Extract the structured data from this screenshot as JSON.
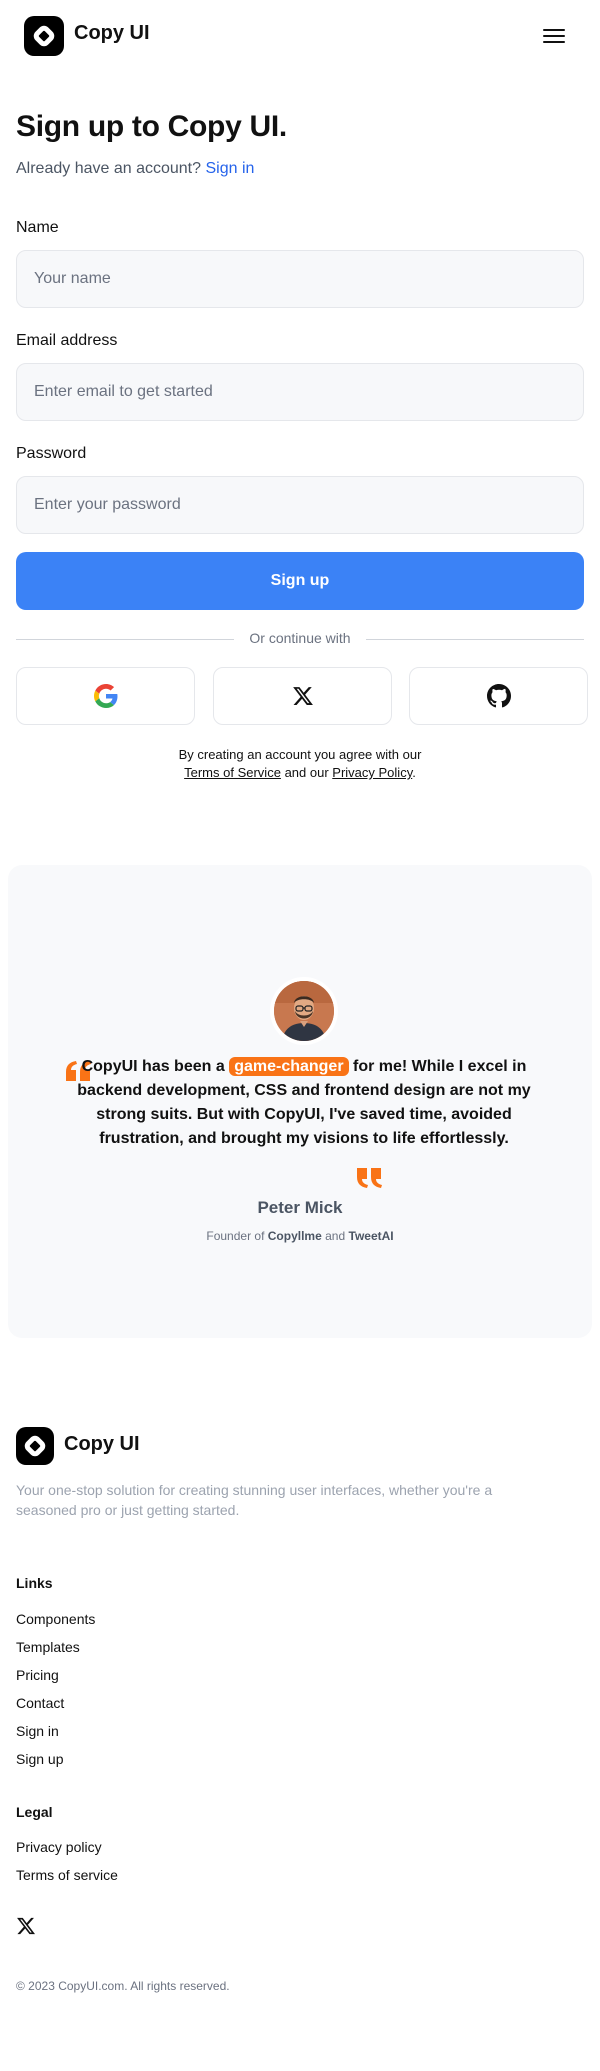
{
  "header": {
    "brand": "Copy UI",
    "menu_icon": "hamburger-menu-icon"
  },
  "signup": {
    "title": "Sign up to Copy UI.",
    "have_account": "Already have an account?",
    "signin_link": "Sign in",
    "name_label": "Name",
    "name_placeholder": "Your name",
    "email_label": "Email address",
    "email_placeholder": "Enter email to get started",
    "password_label": "Password",
    "password_placeholder": "Enter your password",
    "submit": "Sign up",
    "divider": "Or continue with",
    "social": [
      "google-icon",
      "x-icon",
      "github-icon"
    ],
    "terms_prefix": "By creating an account you agree with our",
    "terms_link": "Terms of Service",
    "terms_and": "and our",
    "privacy_link": "Privacy Policy",
    "terms_end": "."
  },
  "testimonial": {
    "quote_before": "CopyUI has been a ",
    "highlight": "game-changer",
    "quote_after": " for me! While I excel in backend development, CSS and frontend design are not my strong suits. But with CopyUI, I've saved time, avoided frustration, and brought my visions to life effortlessly.",
    "name": "Peter Mick",
    "role_prefix": "Founder of",
    "company1": "Copyllme",
    "role_and": "and",
    "company2": "TweetAI",
    "accent": "#f97316"
  },
  "footer": {
    "brand": "Copy UI",
    "tagline": "Your one-stop solution for creating stunning user interfaces, whether you're a seasoned pro or just getting started.",
    "links_heading": "Links",
    "links": [
      "Components",
      "Templates",
      "Pricing",
      "Contact",
      "Sign in",
      "Sign up"
    ],
    "legal_heading": "Legal",
    "legal": [
      "Privacy policy",
      "Terms of service"
    ],
    "social_icon": "x-icon",
    "copyright": "© 2023 CopyUI.com. All rights reserved."
  },
  "colors": {
    "primary": "#3b82f6",
    "link": "#2563eb",
    "accent": "#f97316"
  }
}
